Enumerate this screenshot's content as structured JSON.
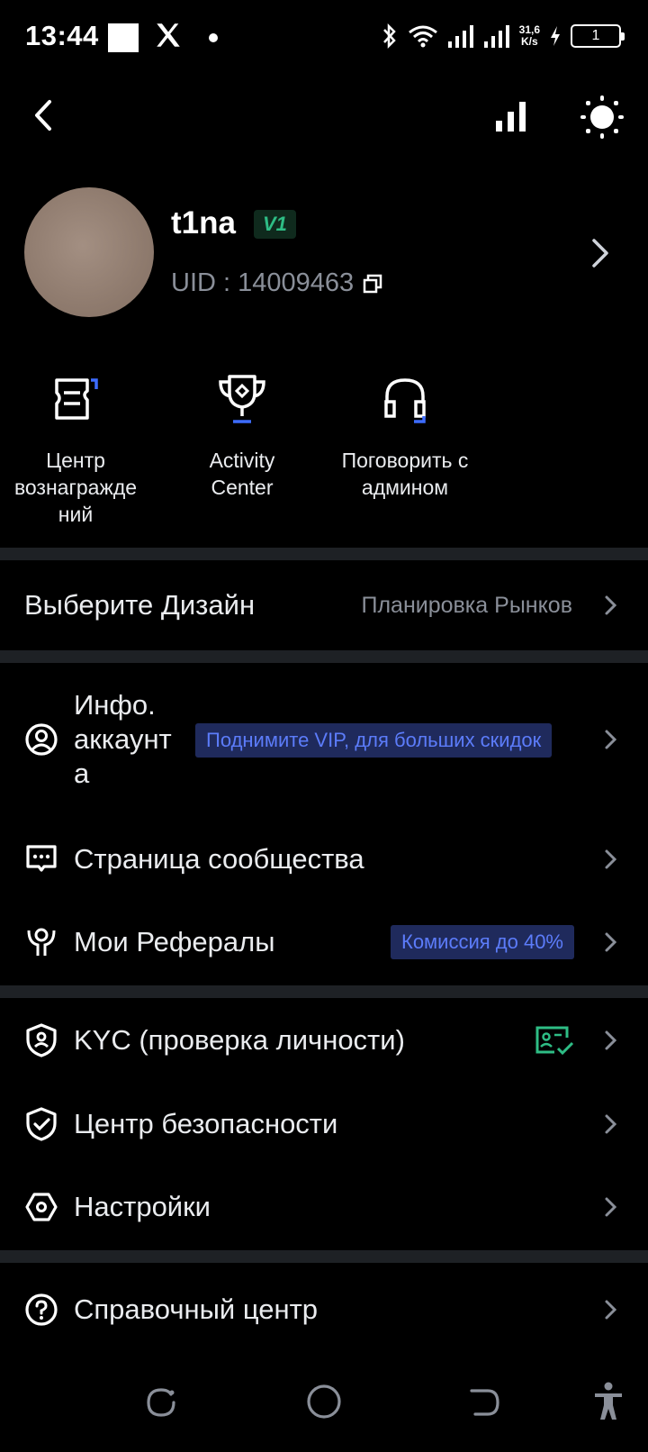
{
  "status_bar": {
    "time": "13:44",
    "speed_value": "31,6",
    "speed_unit": "K/s",
    "battery": "1",
    "icons": [
      "x-logo-icon",
      "bluetooth-icon",
      "wifi-icon",
      "signal-icon",
      "signal-icon",
      "charging-icon",
      "battery-icon"
    ]
  },
  "header": {
    "back_icon": "chevron-left-icon",
    "chart_icon": "bar-chart-icon",
    "theme_icon": "sun-icon"
  },
  "profile": {
    "username": "t1na",
    "vip_level": "V1",
    "uid_label": "UID : 14009463",
    "copy_icon": "copy-icon"
  },
  "quick_actions": [
    {
      "label": "Центр вознагражде ний",
      "icon": "reward-ticket-icon"
    },
    {
      "label": "Activity Center",
      "icon": "trophy-icon"
    },
    {
      "label": "Поговорить с админом",
      "icon": "headset-icon"
    }
  ],
  "design": {
    "label": "Выберите Дизайн",
    "value": "Планировка Рынков"
  },
  "menu": {
    "account": {
      "label": "Инфо. аккаунт а",
      "tag": "Поднимите VIP, для больших скидок",
      "icon": "user-circle-icon"
    },
    "community": {
      "label": "Страница сообщества",
      "icon": "chat-icon"
    },
    "referrals": {
      "label": "Мои Рефералы",
      "tag": "Комиссия до 40%",
      "icon": "referral-icon"
    },
    "kyc": {
      "label": "KYC (проверка личности)",
      "icon": "shield-user-icon",
      "status_icon": "id-verified-icon"
    },
    "security": {
      "label": "Центр безопасности",
      "icon": "shield-check-icon"
    },
    "settings": {
      "label": "Настройки",
      "icon": "hexagon-settings-icon"
    },
    "help": {
      "label": "Справочный центр",
      "icon": "help-circle-icon"
    }
  },
  "colors": {
    "background": "#000000",
    "divider": "#1e2125",
    "accent_blue": "#5c7cfa",
    "accent_green": "#2ebd85",
    "muted_text": "#8a8f99"
  }
}
